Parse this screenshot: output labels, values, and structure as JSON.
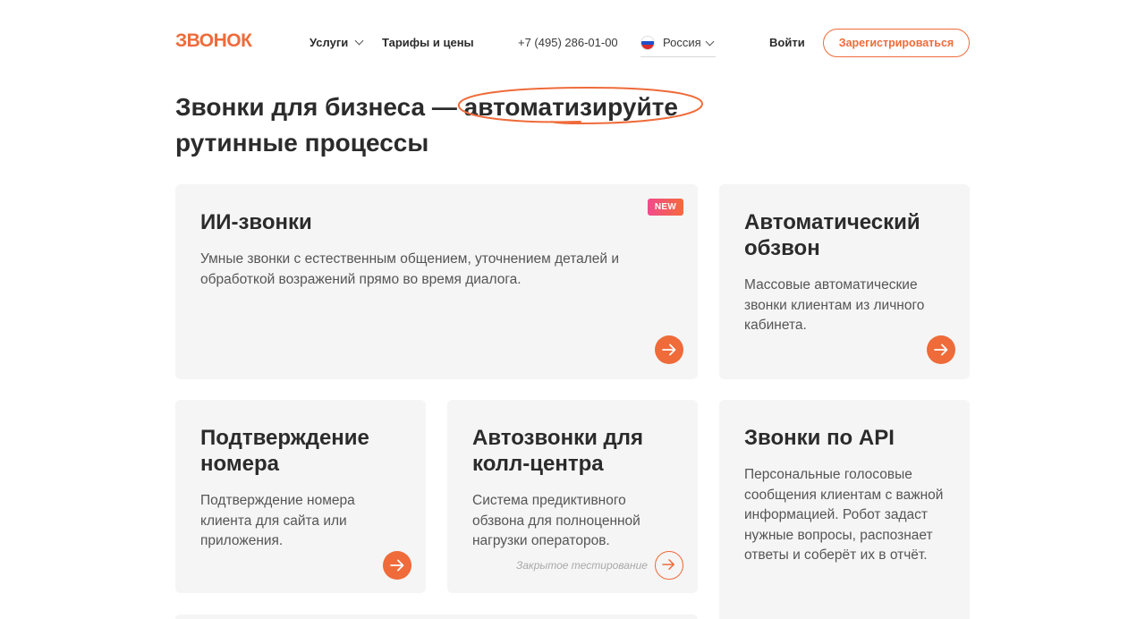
{
  "header": {
    "logo": "ЗВОНОК",
    "nav": {
      "services": "Услуги",
      "tariffs": "Тарифы и цены"
    },
    "phone": "+7 (495) 286-01-00",
    "region": "Россия",
    "login": "Войти",
    "register": "Зарегистрироваться"
  },
  "title": {
    "part1": "Звонки для бизнеса — ",
    "highlight": "автоматизируйте",
    "part2": "рутинные процессы"
  },
  "cards": [
    {
      "title": "ИИ-звонки",
      "text": "Умные звонки с естественным общением, уточнением деталей и обработкой возражений прямо во время диалога.",
      "badge": "NEW"
    },
    {
      "title": "Автоматический обзвон",
      "text": "Массовые автоматические звонки клиентам из личного кабинета."
    },
    {
      "title": "Подтверждение номера",
      "text": "Подтверждение номера клиента для сайта или приложения."
    },
    {
      "title": "Автозвонки для колл-центра",
      "text": "Система предиктивного обзвона для полноценной нагрузки операторов.",
      "note": "Закрытое тестирование"
    },
    {
      "title": "Звонки по API",
      "text": "Персональные голосовые сообщения клиентам с важной информацией. Робот задаст нужные вопросы, распознает ответы и соберёт их в отчёт."
    }
  ],
  "colors": {
    "accent": "#ef6b3a",
    "card_bg": "#f5f5f5",
    "text": "#2b2b2b"
  },
  "icons": {
    "arrow": "arrow-right-icon",
    "chevron": "chevron-down-icon",
    "flag": "russia-flag-icon"
  }
}
